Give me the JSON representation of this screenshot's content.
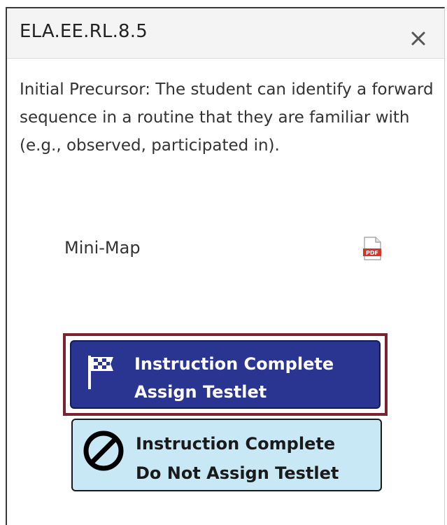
{
  "dialog": {
    "title": "ELA.EE.RL.8.5",
    "close_icon": "close-icon",
    "description": "Initial Precursor: The student can identify a forward sequence in a routine that they are familiar with (e.g., observed, participated in).",
    "minimap": {
      "label": "Mini-Map",
      "icon": "pdf-icon",
      "icon_text": "PDF"
    },
    "buttons": {
      "assign": {
        "line1": "Instruction Complete",
        "line2": "Assign Testlet",
        "icon": "checkered-flag-icon",
        "background": "#2a3491",
        "highlight_border": "#7a2430"
      },
      "do_not_assign": {
        "line1": "Instruction Complete",
        "line2": "Do Not Assign Testlet",
        "icon": "prohibited-icon",
        "background": "#c9e8f6"
      }
    }
  }
}
